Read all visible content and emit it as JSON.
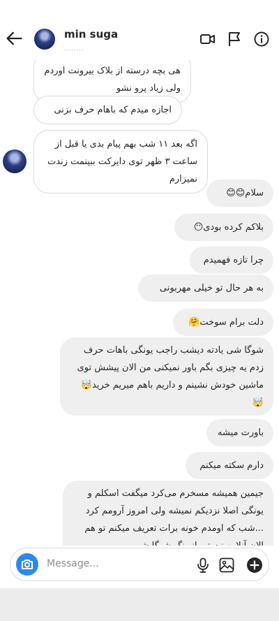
{
  "header": {
    "username": "min suga",
    "status": "........"
  },
  "messages": {
    "m0": "هی بچه درسته از بلاک بیرونت اوردم ولی زیاد پرو نشو",
    "m1": "اجازه میدم که باهام حرف بزنی",
    "m2": "اگه بعد ۱۱ شب بهم پیام بدی یا قبل از ساعت ۳ ظهر توی دایرکت ببینمت زندت نمیزارم",
    "m3": "سلام😊😊",
    "m4": "بلاکم کرده بودی😶",
    "m5": "چرا تازه فهمیدم",
    "m6": "به هر حال تو خیلی مهربونی",
    "m7": "دلت برام سوخت🤗",
    "m8": "شوگا شی یادته دیشب راجب یونگی باهات حرف زدم یه چیزی بگم باور نمیکنی من الان پیشش توی ماشین خودش نشینم و داریم باهم میریم خرید🤯🤯",
    "m9": "باورت میشه",
    "m10": "دارم سکته میکنم",
    "m11": "جیمین همیشه مسخرم می‌کرد میگفت اسکلم و یونگی اصلا نزدیکم نمیشه ولی امروز آرومم کرد ...شب که اومدم خونه برات تعریف میکنم تو هم الان آنلاین نیستی انیونگ شوگا شی"
  },
  "composer": {
    "placeholder": "Message..."
  },
  "icons": {
    "back": "arrow-left-icon",
    "video": "video-camera-icon",
    "flag": "flag-icon",
    "info": "info-icon",
    "camera": "camera-icon",
    "mic": "microphone-icon",
    "gallery": "gallery-icon",
    "plus": "add-circle-icon"
  },
  "colors": {
    "accent": "#2a8ae8",
    "outgoing_bubble": "#efefef",
    "incoming_border": "#dbdbdb"
  }
}
